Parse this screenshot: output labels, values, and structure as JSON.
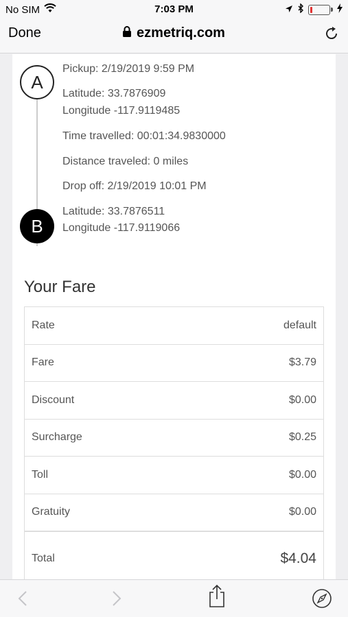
{
  "status_bar": {
    "carrier": "No SIM",
    "time": "7:03 PM",
    "icons": [
      "wifi-icon",
      "location-arrow-icon",
      "bluetooth-icon",
      "battery-icon",
      "charging-icon"
    ],
    "battery_level": 0.1,
    "battery_color": "#e33333"
  },
  "browser": {
    "done_label": "Done",
    "url": "ezmetriq.com",
    "icons": [
      "lock-icon",
      "reload-icon"
    ]
  },
  "trip": {
    "marker_a": "A",
    "marker_b": "B",
    "pickup": "Pickup: 2/19/2019 9:59 PM",
    "pickup_latitude": "Latitude: 33.7876909",
    "pickup_longitude": "Longitude -117.9119485",
    "time_travelled": "Time travelled: 00:01:34.9830000",
    "distance": "Distance traveled: 0 miles",
    "dropoff": "Drop off: 2/19/2019 10:01 PM",
    "dropoff_latitude": "Latitude: 33.7876511",
    "dropoff_longitude": "Longitude -117.9119066"
  },
  "fare": {
    "title": "Your Fare",
    "rows": [
      {
        "label": "Rate",
        "value": "default"
      },
      {
        "label": "Fare",
        "value": "$3.79"
      },
      {
        "label": "Discount",
        "value": "$0.00"
      },
      {
        "label": "Surcharge",
        "value": "$0.25"
      },
      {
        "label": "Toll",
        "value": "$0.00"
      },
      {
        "label": "Gratuity",
        "value": "$0.00"
      }
    ],
    "total_label": "Total",
    "total_value": "$4.04"
  },
  "toolbar": {
    "icons": [
      "back-icon",
      "forward-icon",
      "share-icon",
      "compass-icon"
    ]
  }
}
